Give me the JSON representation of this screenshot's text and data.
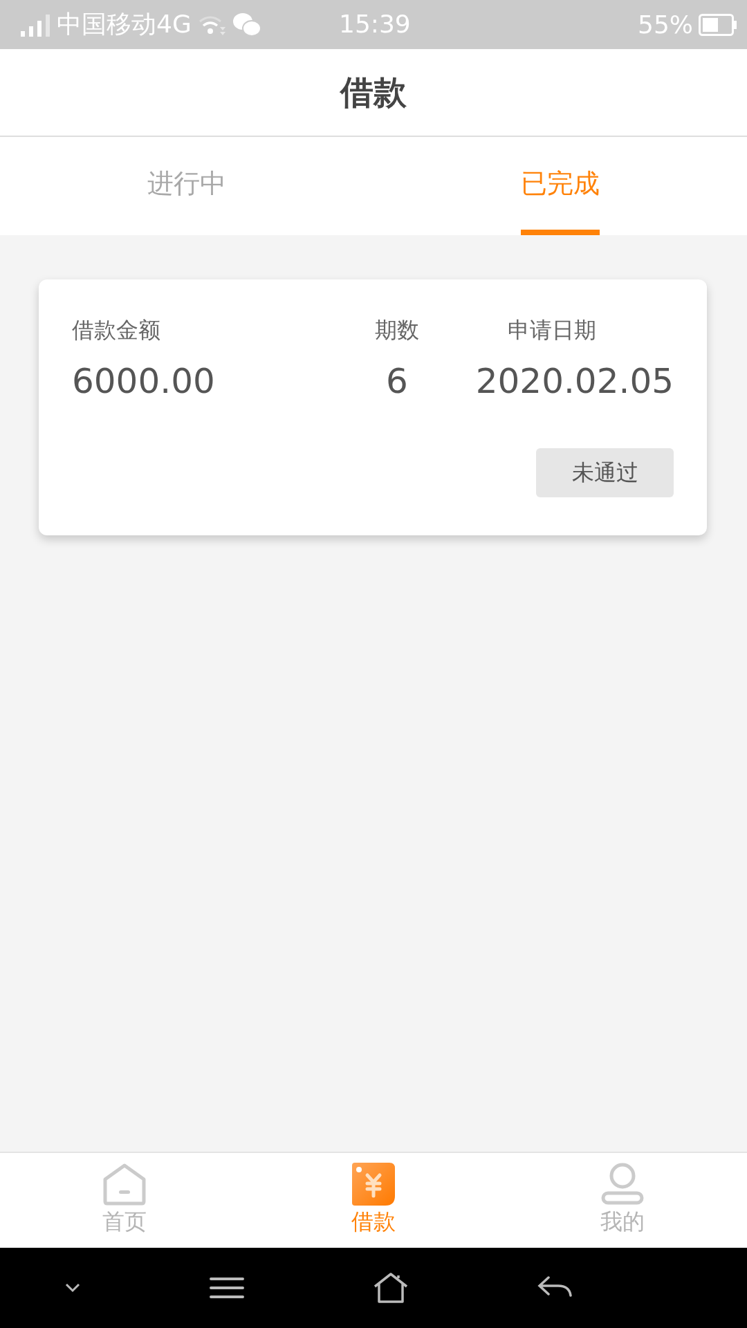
{
  "status_bar": {
    "carrier": "中国移动4G",
    "time": "15:39",
    "battery": "55%"
  },
  "header": {
    "title": "借款"
  },
  "tabs": [
    {
      "label": "进行中",
      "selected": false
    },
    {
      "label": "已完成",
      "selected": true
    }
  ],
  "loans": [
    {
      "fields": [
        {
          "label": "借款金额",
          "value": "6000.00"
        },
        {
          "label": "期数",
          "value": "6"
        },
        {
          "label": "申请日期",
          "value": "2020.02.05"
        }
      ],
      "status": "未通过"
    }
  ],
  "bottom_nav": [
    {
      "kind": "home",
      "label": "首页",
      "selected": false
    },
    {
      "kind": "loan",
      "label": "借款",
      "selected": true
    },
    {
      "kind": "profile",
      "label": "我的",
      "selected": false
    }
  ]
}
